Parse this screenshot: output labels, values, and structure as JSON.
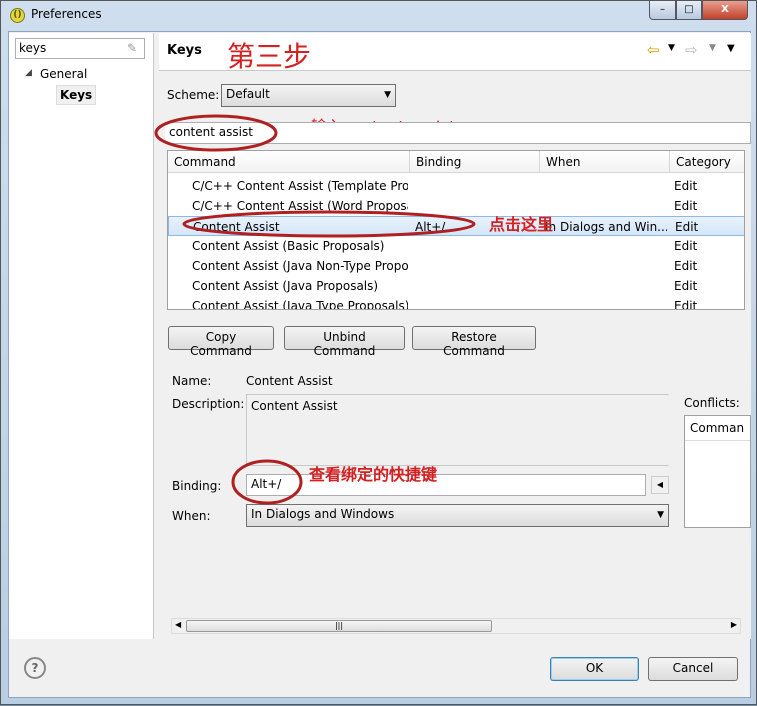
{
  "window": {
    "title": "Preferences",
    "minimize": "–",
    "maximize": "□",
    "close": "X"
  },
  "sidebar": {
    "filter_value": "keys",
    "tree": [
      {
        "label": "General"
      },
      {
        "label": "Keys"
      }
    ]
  },
  "page": {
    "title": "Keys",
    "nav_back": "⇦",
    "nav_fwd": "⇨"
  },
  "scheme": {
    "label": "Scheme:",
    "value": "Default"
  },
  "search": {
    "value": "content assist"
  },
  "table": {
    "columns": [
      "Command",
      "Binding",
      "When",
      "Category"
    ],
    "rows": [
      {
        "command": "C/C++ Content Assist (Template Prop",
        "binding": "",
        "when": "",
        "category": "Edit"
      },
      {
        "command": "C/C++ Content Assist (Word Proposa",
        "binding": "",
        "when": "",
        "category": "Edit"
      },
      {
        "command": "Content Assist",
        "binding": "Alt+/",
        "when": "In Dialogs and Win...",
        "category": "Edit",
        "selected": true
      },
      {
        "command": "Content Assist (Basic Proposals)",
        "binding": "",
        "when": "",
        "category": "Edit"
      },
      {
        "command": "Content Assist (Java Non-Type Propo",
        "binding": "",
        "when": "",
        "category": "Edit"
      },
      {
        "command": "Content Assist (Java Proposals)",
        "binding": "",
        "when": "",
        "category": "Edit"
      },
      {
        "command": "Content Assist (Java Type Proposals)",
        "binding": "",
        "when": "",
        "category": "Edit"
      }
    ]
  },
  "buttons": {
    "copy": "Copy Command",
    "unbind": "Unbind Command",
    "restore": "Restore Command",
    "ok": "OK",
    "cancel": "Cancel"
  },
  "details": {
    "name_label": "Name:",
    "name_value": "Content Assist",
    "description_label": "Description:",
    "description_value": "Content Assist",
    "binding_label": "Binding:",
    "binding_value": "Alt+/",
    "when_label": "When:",
    "when_value": "In Dialogs and Windows",
    "conflicts_label": "Conflicts:",
    "conflicts_column": "Comman"
  },
  "annotations": {
    "step": "第三步",
    "type_hint": "输入content assist",
    "click_hint": "点击这里",
    "binding_hint": "查看绑定的快捷键",
    "color": "#d42020"
  },
  "help": "?"
}
